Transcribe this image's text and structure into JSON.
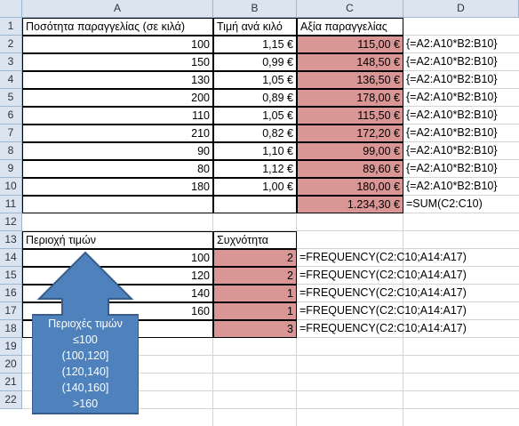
{
  "columns": [
    "A",
    "B",
    "C",
    "D"
  ],
  "rows": [
    "1",
    "2",
    "3",
    "4",
    "5",
    "6",
    "7",
    "8",
    "9",
    "10",
    "11",
    "12",
    "13",
    "14",
    "15",
    "16",
    "17",
    "18",
    "19",
    "20",
    "21",
    "22"
  ],
  "header": {
    "a1": "Ποσότητα παραγγελίας (σε κιλά)",
    "b1": "Τιμή ανά κιλό",
    "c1": "Αξία παραγγελίας"
  },
  "orders": [
    {
      "qty": "100",
      "price": "1,15 €",
      "value": "115,00 €",
      "formula": "{=A2:A10*B2:B10}"
    },
    {
      "qty": "150",
      "price": "0,99 €",
      "value": "148,50 €",
      "formula": "{=A2:A10*B2:B10}"
    },
    {
      "qty": "130",
      "price": "1,05 €",
      "value": "136,50 €",
      "formula": "{=A2:A10*B2:B10}"
    },
    {
      "qty": "200",
      "price": "0,89 €",
      "value": "178,00 €",
      "formula": "{=A2:A10*B2:B10}"
    },
    {
      "qty": "110",
      "price": "1,05 €",
      "value": "115,50 €",
      "formula": "{=A2:A10*B2:B10}"
    },
    {
      "qty": "210",
      "price": "0,82 €",
      "value": "172,20 €",
      "formula": "{=A2:A10*B2:B10}"
    },
    {
      "qty": "90",
      "price": "1,10 €",
      "value": "99,00 €",
      "formula": "{=A2:A10*B2:B10}"
    },
    {
      "qty": "80",
      "price": "1,12 €",
      "value": "89,60 €",
      "formula": "{=A2:A10*B2:B10}"
    },
    {
      "qty": "180",
      "price": "1,00 €",
      "value": "180,00 €",
      "formula": "{=A2:A10*B2:B10}"
    }
  ],
  "total": {
    "value": "1.234,30 €",
    "formula": "=SUM(C2:C10)"
  },
  "freq_header": {
    "a13": "Περιοχή τιμών",
    "b13": "Συχνότητα"
  },
  "freq": [
    {
      "bin": "100",
      "count": "2",
      "formula": "=FREQUENCY(C2:C10;A14:A17)"
    },
    {
      "bin": "120",
      "count": "2",
      "formula": "=FREQUENCY(C2:C10;A14:A17)"
    },
    {
      "bin": "140",
      "count": "1",
      "formula": "=FREQUENCY(C2:C10;A14:A17)"
    },
    {
      "bin": "160",
      "count": "1",
      "formula": "=FREQUENCY(C2:C10;A14:A17)"
    },
    {
      "bin": "",
      "count": "3",
      "formula": "=FREQUENCY(C2:C10;A14:A17)"
    }
  ],
  "callout": {
    "title": "Περιοχές τιμών",
    "lines": [
      "≤100",
      "(100,120]",
      "(120,140]",
      "(140,160]",
      ">160"
    ]
  },
  "colors": {
    "highlight": "#da9694",
    "callout_fill": "#4f81bd",
    "callout_stroke": "#385d8a",
    "header_bg": "#dce4ef"
  }
}
